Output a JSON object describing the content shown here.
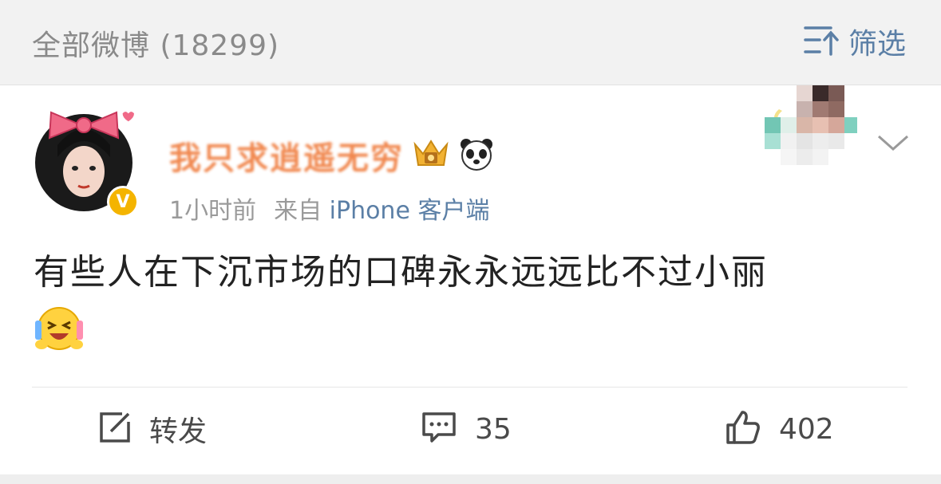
{
  "header": {
    "title": "全部微博 (18299)",
    "filter_label": "筛选",
    "filter_icon": "sort-filter-icon"
  },
  "post": {
    "author_name": "我只求逍遥无穷",
    "badges": [
      "vip-crown-icon",
      "panda-icon"
    ],
    "verified_badge": "V",
    "time": "1小时前",
    "source_prefix": "来自",
    "source": "iPhone 客户端",
    "text": "有些人在下沉市场的口碑永永远远比不过小丽",
    "emoji": "laughing-emoji"
  },
  "actions": {
    "repost_label": "转发",
    "comment_count": "35",
    "like_count": "402"
  },
  "colors": {
    "link": "#5b7fa6",
    "name": "#ef7b3c",
    "verified": "#f4b400"
  }
}
